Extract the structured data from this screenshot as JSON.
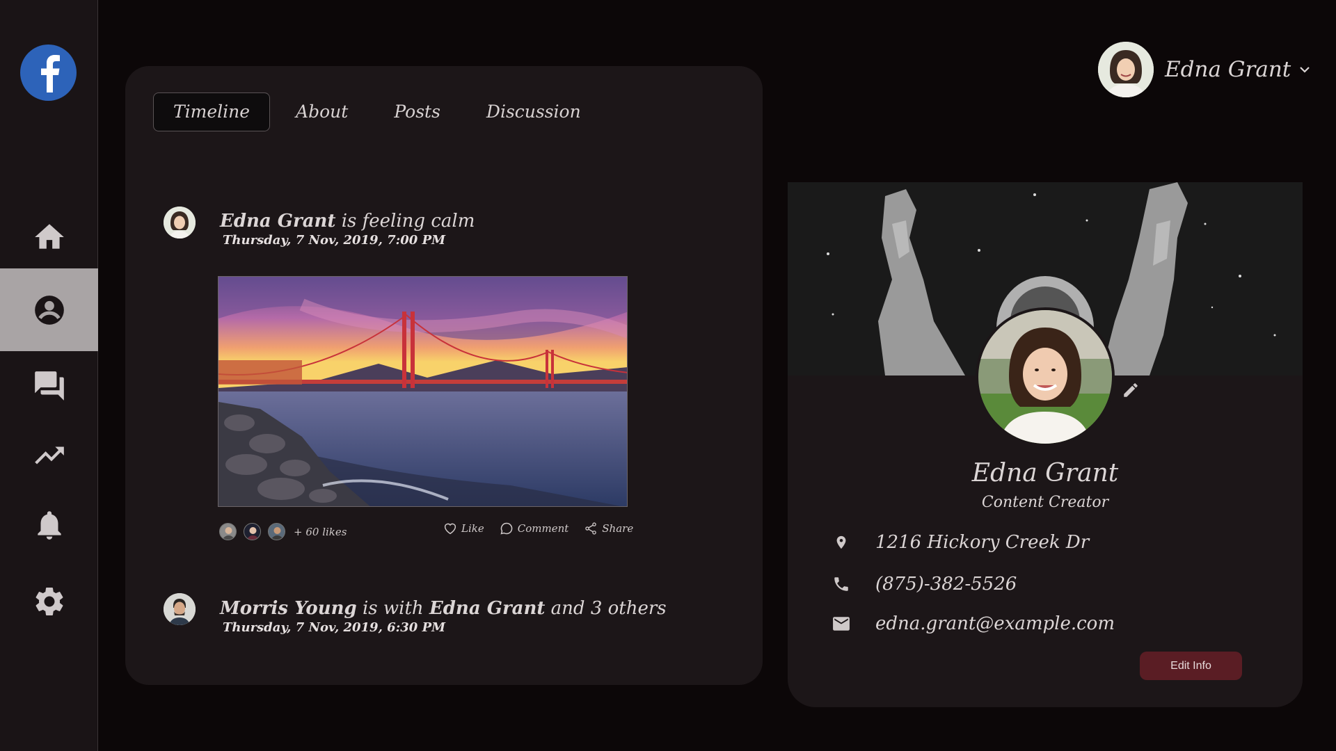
{
  "app": {
    "brand": "facebook"
  },
  "sidebar": {
    "items": [
      {
        "icon": "home-icon",
        "active": false
      },
      {
        "icon": "account-icon",
        "active": true
      },
      {
        "icon": "chat-icon",
        "active": false
      },
      {
        "icon": "trending-icon",
        "active": false
      },
      {
        "icon": "bell-icon",
        "active": false
      },
      {
        "icon": "gear-icon",
        "active": false
      }
    ]
  },
  "header": {
    "user_name": "Edna Grant"
  },
  "tabs": [
    {
      "label": "Timeline",
      "active": true
    },
    {
      "label": "About",
      "active": false
    },
    {
      "label": "Posts",
      "active": false
    },
    {
      "label": "Discussion",
      "active": false
    }
  ],
  "posts": [
    {
      "author": "Edna Grant",
      "text": "is feeling calm",
      "date": "Thursday, 7 Nov, 2019, 7:00 PM",
      "likes": "+ 60 likes",
      "actions": {
        "like": "Like",
        "comment": "Comment",
        "share": "Share"
      }
    },
    {
      "author": "Morris Young",
      "text_with": "is with",
      "tagged": "Edna Grant",
      "others": "and 3 others",
      "date": "Thursday, 7 Nov, 2019, 6:30 PM"
    }
  ],
  "profile": {
    "name": "Edna Grant",
    "role": "Content Creator",
    "address": "1216 Hickory Creek Dr",
    "phone": "(875)-382-5526",
    "email": "edna.grant@example.com",
    "edit_label": "Edit Info"
  },
  "colors": {
    "background": "#0c0708",
    "card": "#1c1618",
    "accent_button": "#5a1d24",
    "brand_blue": "#2d63b9"
  }
}
